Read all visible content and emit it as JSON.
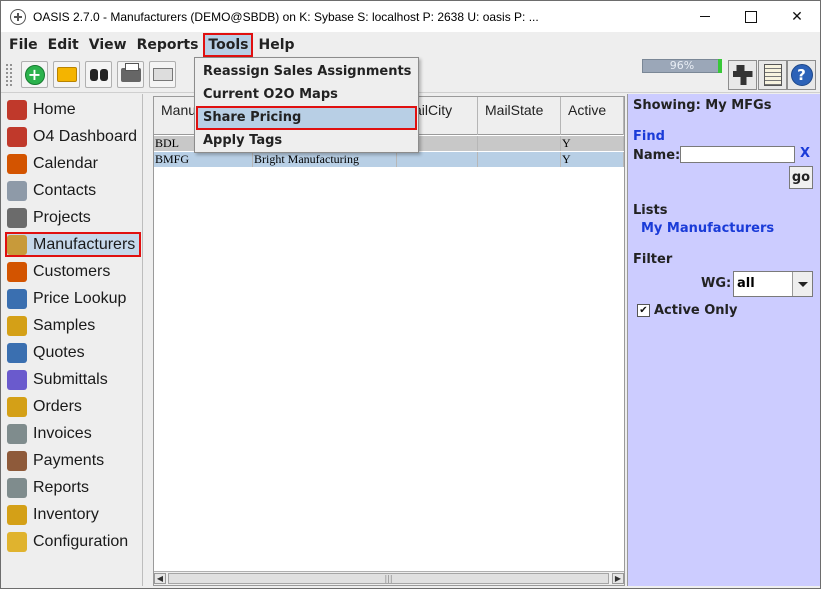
{
  "window": {
    "title": "OASIS 2.7.0 - Manufacturers (DEMO@SBDB) on K: Sybase  S: localhost  P: 2638  U: oasis  P: ...",
    "controls": {
      "close": "✕"
    }
  },
  "menubar": {
    "items": [
      "File",
      "Edit",
      "View",
      "Reports",
      "Tools",
      "Help"
    ],
    "active": "Tools"
  },
  "tools_menu": {
    "items": [
      "Reassign Sales Assignments",
      "Current O2O Maps",
      "Share Pricing",
      "Apply Tags"
    ],
    "highlighted": "Share Pricing"
  },
  "toolbar": {
    "buttons": [
      "add-icon",
      "folder-icon",
      "binoculars-icon",
      "printer-icon",
      "mail-icon"
    ],
    "progress_label": "96%",
    "progress_value": 0.96,
    "right_buttons": [
      "robot-icon",
      "document-icon",
      "help-icon"
    ],
    "add_glyph": "+",
    "help_glyph": "?"
  },
  "sidebar": {
    "items": [
      {
        "label": "Home",
        "icon": "home-icon",
        "color": "#c0392b"
      },
      {
        "label": "O4 Dashboard",
        "icon": "dashboard-icon",
        "color": "#c0392b"
      },
      {
        "label": "Calendar",
        "icon": "calendar-icon",
        "color": "#d35400"
      },
      {
        "label": "Contacts",
        "icon": "contacts-icon",
        "color": "#8e9aa8"
      },
      {
        "label": "Projects",
        "icon": "projects-icon",
        "color": "#6b6b6b"
      },
      {
        "label": "Manufacturers",
        "icon": "manufacturers-icon",
        "color": "#c89a3a"
      },
      {
        "label": "Customers",
        "icon": "customers-icon",
        "color": "#d35400"
      },
      {
        "label": "Price Lookup",
        "icon": "price-lookup-icon",
        "color": "#3a6fb0"
      },
      {
        "label": "Samples",
        "icon": "samples-icon",
        "color": "#d4a017"
      },
      {
        "label": "Quotes",
        "icon": "quotes-icon",
        "color": "#3a6fb0"
      },
      {
        "label": "Submittals",
        "icon": "submittals-icon",
        "color": "#6a5acd"
      },
      {
        "label": "Orders",
        "icon": "orders-icon",
        "color": "#d4a017"
      },
      {
        "label": "Invoices",
        "icon": "invoices-icon",
        "color": "#7f8c8d"
      },
      {
        "label": "Payments",
        "icon": "payments-icon",
        "color": "#8e5a3a"
      },
      {
        "label": "Reports",
        "icon": "reports-icon",
        "color": "#7f8c8d"
      },
      {
        "label": "Inventory",
        "icon": "inventory-icon",
        "color": "#d4a017"
      },
      {
        "label": "Configuration",
        "icon": "configuration-icon",
        "color": "#e0b32e"
      }
    ],
    "active": "Manufacturers"
  },
  "table": {
    "columns": [
      "Manu",
      "",
      "ailCity",
      "MailState",
      "Active"
    ],
    "rows": [
      {
        "code": "BDL",
        "name": "",
        "city": "",
        "state": "",
        "active": "Y",
        "state_style": "selected"
      },
      {
        "code": "BMFG",
        "name": "Bright Manufacturing",
        "city": "",
        "state": "",
        "active": "Y",
        "state_style": "highlighted"
      }
    ],
    "scroll": {
      "left": "◀",
      "thumb": "|||",
      "right": "▶"
    }
  },
  "right_panel": {
    "showing": "Showing: My MFGs",
    "find": "Find",
    "name_label": "Name:",
    "name_value": "",
    "clear": "X",
    "go": "go",
    "lists_heading": "Lists",
    "lists_item": "My Manufacturers",
    "filter_heading": "Filter",
    "wg_label": "WG:",
    "wg_value": "all",
    "active_only_label": "Active Only",
    "active_only_checked": true,
    "check_glyph": "✔",
    "bg_color": "#ccccff"
  }
}
